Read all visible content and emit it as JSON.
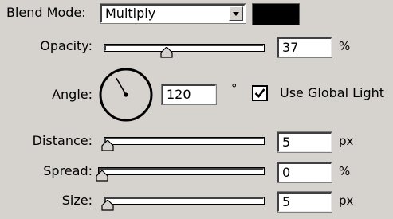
{
  "blend_mode": {
    "label": "Blend Mode:",
    "selected": "Multiply",
    "swatch_color": "#000000"
  },
  "opacity": {
    "label": "Opacity:",
    "value": "37",
    "unit": "%",
    "slider_fraction": 0.37
  },
  "angle": {
    "label": "Angle:",
    "value": "120",
    "unit": "°",
    "degrees": 120
  },
  "global_light": {
    "label": "Use Global Light",
    "checked": true
  },
  "distance": {
    "label": "Distance:",
    "value": "5",
    "unit": "px",
    "slider_fraction": 0.0
  },
  "spread": {
    "label": "Spread:",
    "value": "0",
    "unit": "%",
    "slider_fraction": 0.0
  },
  "size": {
    "label": "Size:",
    "value": "5",
    "unit": "px",
    "slider_fraction": 0.0
  },
  "icons": [
    "dropdown-arrow-icon",
    "slider-thumb-icon",
    "angle-dial-icon",
    "checkmark-icon"
  ]
}
